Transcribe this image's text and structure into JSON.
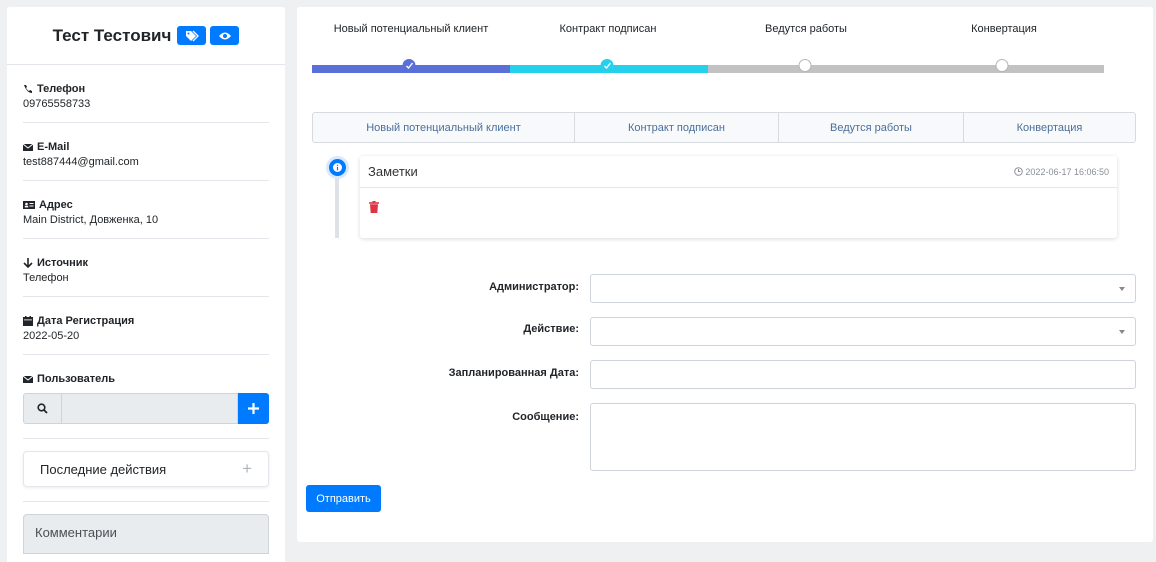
{
  "contact": {
    "name": "Тест Тестович",
    "phone_label": "Телефон",
    "phone": "09765558733",
    "email_label": "E-Mail",
    "email": "test887444@gmail.com",
    "address_label": "Адрес",
    "address": "Main District, Довженка, 10",
    "source_label": "Источник",
    "source": "Телефон",
    "reg_label": "Дата Регистрация",
    "reg_date": "2022-05-20",
    "user_label": "Пользователь"
  },
  "recent_actions": "Последние действия",
  "comments_label": "Комментарии",
  "pipeline": {
    "steps": [
      "Новый потенциальный клиент",
      "Контракт подписан",
      "Ведутся работы",
      "Конвертация"
    ],
    "completed": 2
  },
  "tabs": [
    "Новый потенциальный клиент",
    "Контракт подписан",
    "Ведутся работы",
    "Конвертация"
  ],
  "note": {
    "title": "Заметки",
    "timestamp": "2022-06-17 16:06:50"
  },
  "form": {
    "admin_label": "Администратор:",
    "action_label": "Действие:",
    "date_label": "Запланированная Дата:",
    "message_label": "Сообщение:",
    "submit": "Отправить"
  },
  "colors": {
    "primary": "#007bff",
    "step1": "#5b6fd8",
    "step2": "#25d0ec",
    "step_inactive": "#c2c2c2",
    "danger": "#dc3545"
  }
}
